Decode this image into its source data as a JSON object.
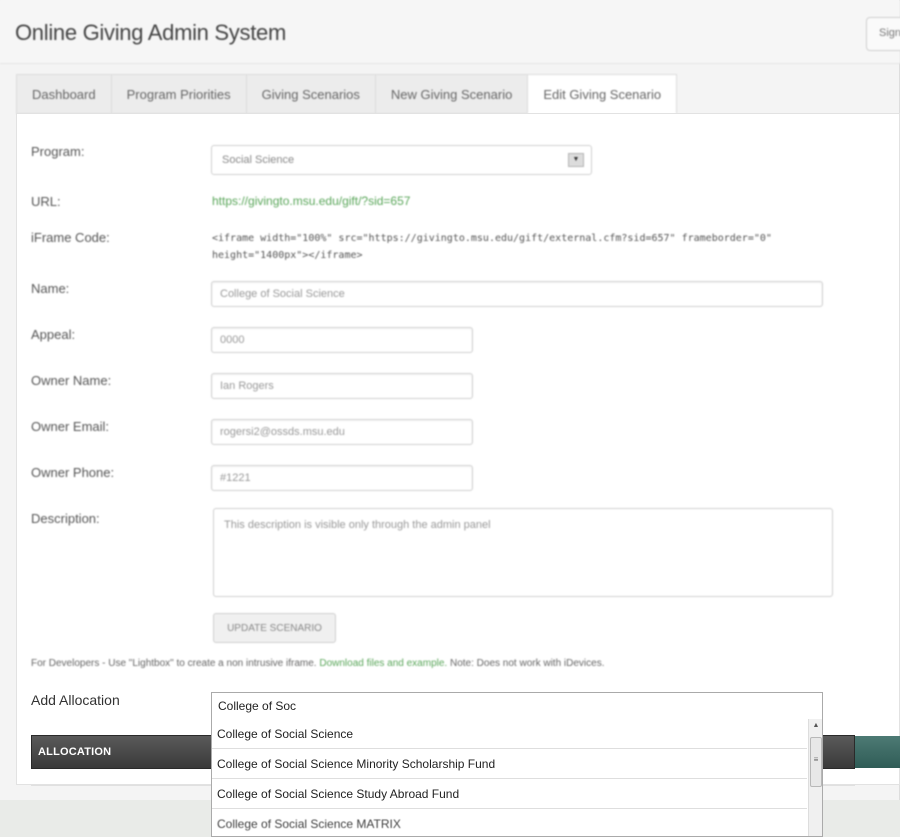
{
  "header": {
    "title": "Online Giving Admin System",
    "right_button": "Sign"
  },
  "tabs": [
    {
      "label": "Dashboard"
    },
    {
      "label": "Program Priorities"
    },
    {
      "label": "Giving Scenarios"
    },
    {
      "label": "New Giving Scenario"
    },
    {
      "label": "Edit Giving Scenario"
    }
  ],
  "form": {
    "program_label": "Program:",
    "program_value": "Social Science",
    "url_label": "URL:",
    "url_value": "https://givingto.msu.edu/gift/?sid=657",
    "iframe_label": "iFrame Code:",
    "iframe_value": "<iframe width=\"100%\" src=\"https://givingto.msu.edu/gift/external.cfm?sid=657\" frameborder=\"0\" height=\"1400px\"></iframe>",
    "name_label": "Name:",
    "name_value": "College of Social Science",
    "appeal_label": "Appeal:",
    "appeal_value": "0000",
    "owner_name_label": "Owner Name:",
    "owner_name_value": "Ian Rogers",
    "owner_email_label": "Owner Email:",
    "owner_email_value": "rogersi2@ossds.msu.edu",
    "owner_phone_label": "Owner Phone:",
    "owner_phone_value": "#1221",
    "description_label": "Description:",
    "description_placeholder": "This description is visible only through the admin panel",
    "update_button": "UPDATE SCENARIO"
  },
  "dev_note": {
    "prefix": "For Developers - Use \"Lightbox\" to create a non intrusive iframe.",
    "link": "Download files and example.",
    "suffix": "Note: Does not work with iDevices."
  },
  "allocation": {
    "label": "Add Allocation",
    "input_value": "College of Soc",
    "table_header": "ALLOCATION",
    "suggestions": [
      "College of Social Science",
      "College of Social Science Minority Scholarship Fund",
      "College of Social Science Study Abroad Fund",
      "College of Social Science MATRIX"
    ]
  },
  "colors": {
    "link_green": "#5aa65a",
    "table_header_dark": "#3a3a3a",
    "teal_strip": "#2f5c56"
  }
}
